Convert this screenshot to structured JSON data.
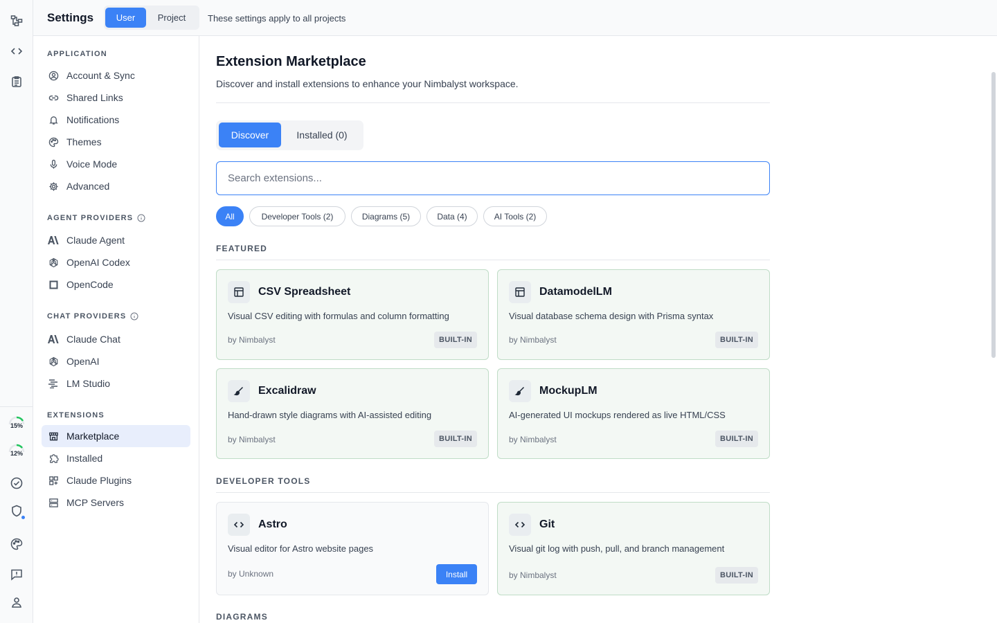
{
  "header": {
    "title": "Settings",
    "scope_user": "User",
    "scope_project": "Project",
    "note": "These settings apply to all projects"
  },
  "rail": {
    "usage": [
      {
        "label": "15%",
        "value": 15,
        "color": "#22c55e"
      },
      {
        "label": "12%",
        "value": 12,
        "color": "#22c55e"
      }
    ],
    "icons": [
      "flow-icon",
      "code-icon",
      "clipboard-icon",
      "check-circle-icon",
      "shield-icon",
      "palette-icon",
      "feedback-icon",
      "user-icon"
    ]
  },
  "sidebar": {
    "application": {
      "title": "APPLICATION",
      "items": [
        {
          "label": "Account & Sync",
          "icon": "account-icon"
        },
        {
          "label": "Shared Links",
          "icon": "link-icon"
        },
        {
          "label": "Notifications",
          "icon": "bell-icon"
        },
        {
          "label": "Themes",
          "icon": "palette-icon"
        },
        {
          "label": "Voice Mode",
          "icon": "mic-icon"
        },
        {
          "label": "Advanced",
          "icon": "gear-icon"
        }
      ]
    },
    "agent_providers": {
      "title": "AGENT PROVIDERS",
      "items": [
        {
          "label": "Claude Agent",
          "icon": "anthropic-icon"
        },
        {
          "label": "OpenAI Codex",
          "icon": "openai-icon"
        },
        {
          "label": "OpenCode",
          "icon": "square-icon"
        }
      ]
    },
    "chat_providers": {
      "title": "CHAT PROVIDERS",
      "items": [
        {
          "label": "Claude Chat",
          "icon": "anthropic-icon"
        },
        {
          "label": "OpenAI",
          "icon": "openai-icon"
        },
        {
          "label": "LM Studio",
          "icon": "lmstudio-icon"
        }
      ]
    },
    "extensions": {
      "title": "EXTENSIONS",
      "items": [
        {
          "label": "Marketplace",
          "icon": "store-icon",
          "active": true
        },
        {
          "label": "Installed",
          "icon": "puzzle-icon"
        },
        {
          "label": "Claude Plugins",
          "icon": "grid-plus-icon"
        },
        {
          "label": "MCP Servers",
          "icon": "server-icon"
        }
      ]
    }
  },
  "main": {
    "title": "Extension Marketplace",
    "description": "Discover and install extensions to enhance your Nimbalyst workspace.",
    "tabs": {
      "discover": "Discover",
      "installed": "Installed (0)"
    },
    "search_placeholder": "Search extensions...",
    "chips": [
      "All",
      "Developer Tools (2)",
      "Diagrams (5)",
      "Data (4)",
      "AI Tools (2)"
    ],
    "sections": {
      "featured": "FEATURED",
      "developer_tools": "DEVELOPER TOOLS",
      "diagrams": "DIAGRAMS"
    },
    "featured": [
      {
        "name": "CSV Spreadsheet",
        "desc": "Visual CSV editing with formulas and column formatting",
        "author": "by Nimbalyst",
        "badge": "BUILT-IN",
        "icon": "table-icon"
      },
      {
        "name": "DatamodelLM",
        "desc": "Visual database schema design with Prisma syntax",
        "author": "by Nimbalyst",
        "badge": "BUILT-IN",
        "icon": "table-icon"
      },
      {
        "name": "Excalidraw",
        "desc": "Hand-drawn style diagrams with AI-assisted editing",
        "author": "by Nimbalyst",
        "badge": "BUILT-IN",
        "icon": "brush-icon"
      },
      {
        "name": "MockupLM",
        "desc": "AI-generated UI mockups rendered as live HTML/CSS",
        "author": "by Nimbalyst",
        "badge": "BUILT-IN",
        "icon": "brush-icon"
      }
    ],
    "developer_tools": [
      {
        "name": "Astro",
        "desc": "Visual editor for Astro website pages",
        "author": "by Unknown",
        "action": "Install",
        "icon": "code-icon"
      },
      {
        "name": "Git",
        "desc": "Visual git log with push, pull, and branch management",
        "author": "by Nimbalyst",
        "badge": "BUILT-IN",
        "icon": "code-icon"
      }
    ]
  }
}
